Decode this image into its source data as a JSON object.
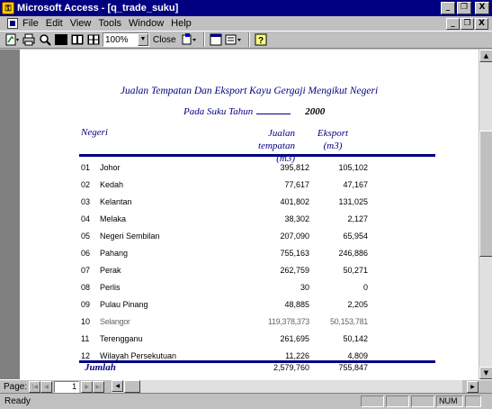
{
  "window": {
    "title": "Microsoft Access - [q_trade_suku]",
    "minimize": "_",
    "restore": "❐",
    "close": "X"
  },
  "menu": [
    {
      "label": "File"
    },
    {
      "label": "Edit"
    },
    {
      "label": "View"
    },
    {
      "label": "Tools"
    },
    {
      "label": "Window"
    },
    {
      "label": "Help"
    }
  ],
  "toolbar": {
    "zoom": "100%",
    "close_label": "Close"
  },
  "report": {
    "title": "Jualan Tempatan Dan Eksport Kayu Gergaji Mengikut Negeri",
    "subtitle": "Pada Suku Tahun",
    "year": "2000",
    "col_state": "Negeri",
    "col_local_1": "Jualan tempatan",
    "col_local_2": "(m3)",
    "col_export_1": "Eksport",
    "col_export_2": "(m3)",
    "rows": [
      {
        "num": "01",
        "state": "Johor",
        "local": "395,812",
        "export": "105,102"
      },
      {
        "num": "02",
        "state": "Kedah",
        "local": "77,617",
        "export": "47,167"
      },
      {
        "num": "03",
        "state": "Kelantan",
        "local": "401,802",
        "export": "131,025"
      },
      {
        "num": "04",
        "state": "Melaka",
        "local": "38,302",
        "export": "2,127"
      },
      {
        "num": "05",
        "state": "Negeri Sembilan",
        "local": "207,090",
        "export": "65,954"
      },
      {
        "num": "06",
        "state": "Pahang",
        "local": "755,163",
        "export": "246,886"
      },
      {
        "num": "07",
        "state": "Perak",
        "local": "262,759",
        "export": "50,271"
      },
      {
        "num": "08",
        "state": "Perlis",
        "local": "30",
        "export": "0"
      },
      {
        "num": "09",
        "state": "Pulau Pinang",
        "local": "48,885",
        "export": "2,205"
      },
      {
        "num": "10",
        "state": "Selangor",
        "local": "119,378,373",
        "export": "50,153,781"
      },
      {
        "num": "11",
        "state": "Terengganu",
        "local": "261,695",
        "export": "50,142"
      },
      {
        "num": "12",
        "state": "Wilayah Persekutuan",
        "local": "11,226",
        "export": "4,809"
      }
    ],
    "total_label": "Jumlah",
    "total_local": "2,579,760",
    "total_export": "755,847"
  },
  "nav": {
    "page_label": "Page:",
    "page_value": "1"
  },
  "status": {
    "text": "Ready",
    "num": "NUM"
  }
}
